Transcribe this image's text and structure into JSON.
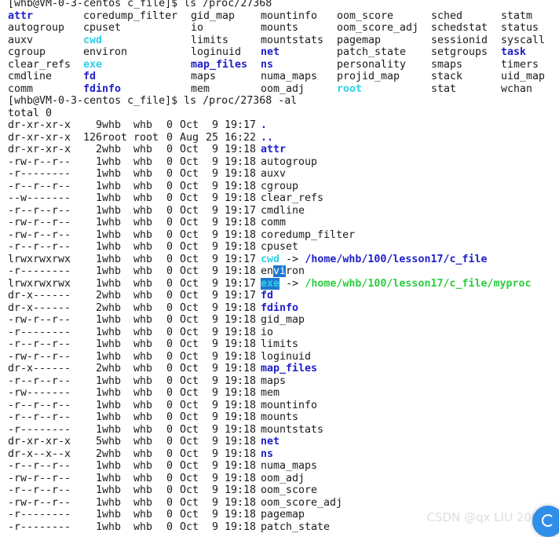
{
  "terminal": {
    "prompt1": "[whb@VM-0-3-centos c_file]$ ls /proc/27368",
    "grid": [
      [
        {
          "t": "attr",
          "c": "blue"
        },
        {
          "t": "coredump_filter",
          "c": ""
        },
        {
          "t": "gid_map",
          "c": ""
        },
        {
          "t": "mountinfo",
          "c": ""
        },
        {
          "t": "oom_score",
          "c": ""
        },
        {
          "t": "sched",
          "c": ""
        },
        {
          "t": "statm",
          "c": ""
        }
      ],
      [
        {
          "t": "autogroup",
          "c": ""
        },
        {
          "t": "cpuset",
          "c": ""
        },
        {
          "t": "io",
          "c": ""
        },
        {
          "t": "mounts",
          "c": ""
        },
        {
          "t": "oom_score_adj",
          "c": ""
        },
        {
          "t": "schedstat",
          "c": ""
        },
        {
          "t": "status",
          "c": ""
        }
      ],
      [
        {
          "t": "auxv",
          "c": ""
        },
        {
          "t": "cwd",
          "c": "cyan"
        },
        {
          "t": "limits",
          "c": ""
        },
        {
          "t": "mountstats",
          "c": ""
        },
        {
          "t": "pagemap",
          "c": ""
        },
        {
          "t": "sessionid",
          "c": ""
        },
        {
          "t": "syscall",
          "c": ""
        }
      ],
      [
        {
          "t": "cgroup",
          "c": ""
        },
        {
          "t": "environ",
          "c": ""
        },
        {
          "t": "loginuid",
          "c": ""
        },
        {
          "t": "net",
          "c": "blue"
        },
        {
          "t": "patch_state",
          "c": ""
        },
        {
          "t": "setgroups",
          "c": ""
        },
        {
          "t": "task",
          "c": "blue"
        }
      ],
      [
        {
          "t": "clear_refs",
          "c": ""
        },
        {
          "t": "exe",
          "c": "cyan"
        },
        {
          "t": "map_files",
          "c": "blue"
        },
        {
          "t": "ns",
          "c": "blue"
        },
        {
          "t": "personality",
          "c": ""
        },
        {
          "t": "smaps",
          "c": ""
        },
        {
          "t": "timers",
          "c": ""
        }
      ],
      [
        {
          "t": "cmdline",
          "c": ""
        },
        {
          "t": "fd",
          "c": "blue"
        },
        {
          "t": "maps",
          "c": ""
        },
        {
          "t": "numa_maps",
          "c": ""
        },
        {
          "t": "projid_map",
          "c": ""
        },
        {
          "t": "stack",
          "c": ""
        },
        {
          "t": "uid_map",
          "c": ""
        }
      ],
      [
        {
          "t": "comm",
          "c": ""
        },
        {
          "t": "fdinfo",
          "c": "blue"
        },
        {
          "t": "mem",
          "c": ""
        },
        {
          "t": "oom_adj",
          "c": ""
        },
        {
          "t": "root",
          "c": "cyan"
        },
        {
          "t": "stat",
          "c": ""
        },
        {
          "t": "wchan",
          "c": ""
        }
      ]
    ],
    "prompt2": "[whb@VM-0-3-centos c_file]$ ls /proc/27368 -al",
    "total": "total 0",
    "rows": [
      {
        "perm": "dr-xr-xr-x",
        "links": "9",
        "owner": "whb",
        "group": "whb",
        "size": "0",
        "month": "Oct",
        "day": "9",
        "time": "19:17",
        "name": ".",
        "c": "blue"
      },
      {
        "perm": "dr-xr-xr-x",
        "links": "126",
        "owner": "root",
        "group": "root",
        "size": "0",
        "month": "Aug",
        "day": "25",
        "time": "16:22",
        "name": "..",
        "c": "blue"
      },
      {
        "perm": "dr-xr-xr-x",
        "links": "2",
        "owner": "whb",
        "group": "whb",
        "size": "0",
        "month": "Oct",
        "day": "9",
        "time": "19:18",
        "name": "attr",
        "c": "blue"
      },
      {
        "perm": "-rw-r--r--",
        "links": "1",
        "owner": "whb",
        "group": "whb",
        "size": "0",
        "month": "Oct",
        "day": "9",
        "time": "19:18",
        "name": "autogroup",
        "c": ""
      },
      {
        "perm": "-r--------",
        "links": "1",
        "owner": "whb",
        "group": "whb",
        "size": "0",
        "month": "Oct",
        "day": "9",
        "time": "19:18",
        "name": "auxv",
        "c": ""
      },
      {
        "perm": "-r--r--r--",
        "links": "1",
        "owner": "whb",
        "group": "whb",
        "size": "0",
        "month": "Oct",
        "day": "9",
        "time": "19:18",
        "name": "cgroup",
        "c": ""
      },
      {
        "perm": "--w-------",
        "links": "1",
        "owner": "whb",
        "group": "whb",
        "size": "0",
        "month": "Oct",
        "day": "9",
        "time": "19:18",
        "name": "clear_refs",
        "c": ""
      },
      {
        "perm": "-r--r--r--",
        "links": "1",
        "owner": "whb",
        "group": "whb",
        "size": "0",
        "month": "Oct",
        "day": "9",
        "time": "19:17",
        "name": "cmdline",
        "c": ""
      },
      {
        "perm": "-rw-r--r--",
        "links": "1",
        "owner": "whb",
        "group": "whb",
        "size": "0",
        "month": "Oct",
        "day": "9",
        "time": "19:18",
        "name": "comm",
        "c": ""
      },
      {
        "perm": "-rw-r--r--",
        "links": "1",
        "owner": "whb",
        "group": "whb",
        "size": "0",
        "month": "Oct",
        "day": "9",
        "time": "19:18",
        "name": "coredump_filter",
        "c": ""
      },
      {
        "perm": "-r--r--r--",
        "links": "1",
        "owner": "whb",
        "group": "whb",
        "size": "0",
        "month": "Oct",
        "day": "9",
        "time": "19:18",
        "name": "cpuset",
        "c": ""
      },
      {
        "perm": "lrwxrwxrwx",
        "links": "1",
        "owner": "whb",
        "group": "whb",
        "size": "0",
        "month": "Oct",
        "day": "9",
        "time": "19:17",
        "name": "cwd",
        "c": "cyan",
        "arrow": " -> ",
        "target": "/home/whb/100/lesson17/c_file",
        "tc": "blue"
      },
      {
        "perm": "-r--------",
        "links": "1",
        "owner": "whb",
        "group": "whb",
        "size": "0",
        "month": "Oct",
        "day": "9",
        "time": "19:18",
        "name": "environ",
        "c": "",
        "hl": [
          2,
          4
        ]
      },
      {
        "perm": "lrwxrwxrwx",
        "links": "1",
        "owner": "whb",
        "group": "whb",
        "size": "0",
        "month": "Oct",
        "day": "9",
        "time": "19:17",
        "name": "exe",
        "c": "cyan",
        "hlall": true,
        "arrow": " -> ",
        "target": "/home/whb/100/lesson17/c_file/myproc",
        "tc": "green"
      },
      {
        "perm": "dr-x------",
        "links": "2",
        "owner": "whb",
        "group": "whb",
        "size": "0",
        "month": "Oct",
        "day": "9",
        "time": "19:17",
        "name": "fd",
        "c": "blue"
      },
      {
        "perm": "dr-x------",
        "links": "2",
        "owner": "whb",
        "group": "whb",
        "size": "0",
        "month": "Oct",
        "day": "9",
        "time": "19:18",
        "name": "fdinfo",
        "c": "blue"
      },
      {
        "perm": "-rw-r--r--",
        "links": "1",
        "owner": "whb",
        "group": "whb",
        "size": "0",
        "month": "Oct",
        "day": "9",
        "time": "19:18",
        "name": "gid_map",
        "c": ""
      },
      {
        "perm": "-r--------",
        "links": "1",
        "owner": "whb",
        "group": "whb",
        "size": "0",
        "month": "Oct",
        "day": "9",
        "time": "19:18",
        "name": "io",
        "c": ""
      },
      {
        "perm": "-r--r--r--",
        "links": "1",
        "owner": "whb",
        "group": "whb",
        "size": "0",
        "month": "Oct",
        "day": "9",
        "time": "19:18",
        "name": "limits",
        "c": ""
      },
      {
        "perm": "-rw-r--r--",
        "links": "1",
        "owner": "whb",
        "group": "whb",
        "size": "0",
        "month": "Oct",
        "day": "9",
        "time": "19:18",
        "name": "loginuid",
        "c": ""
      },
      {
        "perm": "dr-x------",
        "links": "2",
        "owner": "whb",
        "group": "whb",
        "size": "0",
        "month": "Oct",
        "day": "9",
        "time": "19:18",
        "name": "map_files",
        "c": "blue"
      },
      {
        "perm": "-r--r--r--",
        "links": "1",
        "owner": "whb",
        "group": "whb",
        "size": "0",
        "month": "Oct",
        "day": "9",
        "time": "19:18",
        "name": "maps",
        "c": ""
      },
      {
        "perm": "-rw-------",
        "links": "1",
        "owner": "whb",
        "group": "whb",
        "size": "0",
        "month": "Oct",
        "day": "9",
        "time": "19:18",
        "name": "mem",
        "c": ""
      },
      {
        "perm": "-r--r--r--",
        "links": "1",
        "owner": "whb",
        "group": "whb",
        "size": "0",
        "month": "Oct",
        "day": "9",
        "time": "19:18",
        "name": "mountinfo",
        "c": ""
      },
      {
        "perm": "-r--r--r--",
        "links": "1",
        "owner": "whb",
        "group": "whb",
        "size": "0",
        "month": "Oct",
        "day": "9",
        "time": "19:18",
        "name": "mounts",
        "c": ""
      },
      {
        "perm": "-r--------",
        "links": "1",
        "owner": "whb",
        "group": "whb",
        "size": "0",
        "month": "Oct",
        "day": "9",
        "time": "19:18",
        "name": "mountstats",
        "c": ""
      },
      {
        "perm": "dr-xr-xr-x",
        "links": "5",
        "owner": "whb",
        "group": "whb",
        "size": "0",
        "month": "Oct",
        "day": "9",
        "time": "19:18",
        "name": "net",
        "c": "blue"
      },
      {
        "perm": "dr-x--x--x",
        "links": "2",
        "owner": "whb",
        "group": "whb",
        "size": "0",
        "month": "Oct",
        "day": "9",
        "time": "19:18",
        "name": "ns",
        "c": "blue"
      },
      {
        "perm": "-r--r--r--",
        "links": "1",
        "owner": "whb",
        "group": "whb",
        "size": "0",
        "month": "Oct",
        "day": "9",
        "time": "19:18",
        "name": "numa_maps",
        "c": ""
      },
      {
        "perm": "-rw-r--r--",
        "links": "1",
        "owner": "whb",
        "group": "whb",
        "size": "0",
        "month": "Oct",
        "day": "9",
        "time": "19:18",
        "name": "oom_adj",
        "c": ""
      },
      {
        "perm": "-r--r--r--",
        "links": "1",
        "owner": "whb",
        "group": "whb",
        "size": "0",
        "month": "Oct",
        "day": "9",
        "time": "19:18",
        "name": "oom_score",
        "c": ""
      },
      {
        "perm": "-rw-r--r--",
        "links": "1",
        "owner": "whb",
        "group": "whb",
        "size": "0",
        "month": "Oct",
        "day": "9",
        "time": "19:18",
        "name": "oom_score_adj",
        "c": ""
      },
      {
        "perm": "-r--------",
        "links": "1",
        "owner": "whb",
        "group": "whb",
        "size": "0",
        "month": "Oct",
        "day": "9",
        "time": "19:18",
        "name": "pagemap",
        "c": ""
      },
      {
        "perm": "-r--------",
        "links": "1",
        "owner": "whb",
        "group": "whb",
        "size": "0",
        "month": "Oct",
        "day": "9",
        "time": "19:18",
        "name": "patch_state",
        "c": ""
      }
    ]
  },
  "watermark": "CSDN @qx LIU 2000",
  "colors": {
    "dir": "#2020c8",
    "link": "#2fd0e8",
    "exec": "#2ecc40",
    "selection": "#1e78d0"
  },
  "icons": {
    "badge": "chat-bubble-icon"
  }
}
